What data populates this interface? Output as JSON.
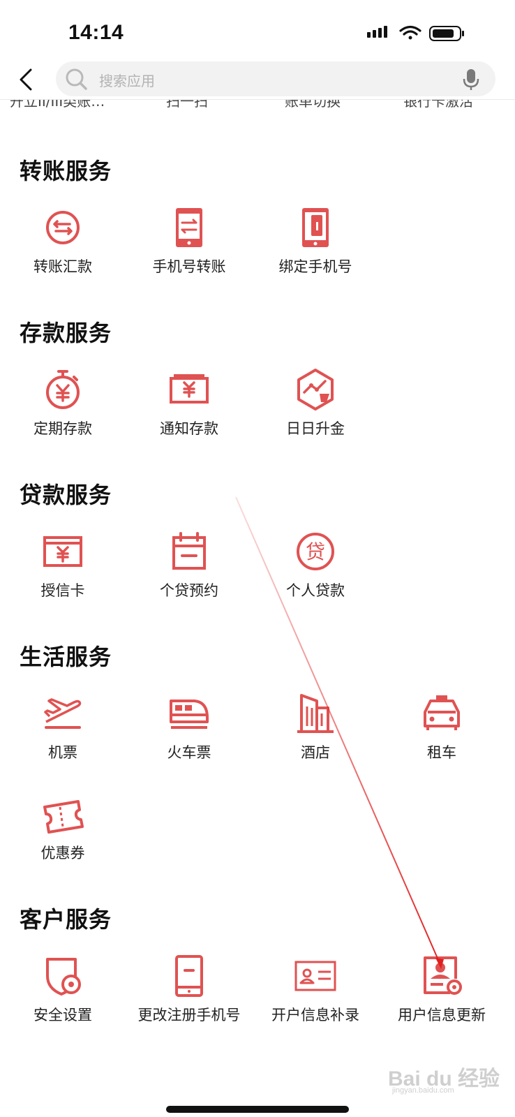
{
  "status": {
    "time": "14:14"
  },
  "search": {
    "placeholder": "搜索应用"
  },
  "top_cut_row": [
    "开立II/III类账…",
    "扫一扫",
    "账单切换",
    "银行卡激活"
  ],
  "sections": [
    {
      "title": "转账服务",
      "items": [
        {
          "label": "转账汇款",
          "icon": "transfer-icon"
        },
        {
          "label": "手机号转账",
          "icon": "phone-transfer-icon"
        },
        {
          "label": "绑定手机号",
          "icon": "bind-phone-icon"
        }
      ]
    },
    {
      "title": "存款服务",
      "items": [
        {
          "label": "定期存款",
          "icon": "time-deposit-icon"
        },
        {
          "label": "通知存款",
          "icon": "notice-deposit-icon"
        },
        {
          "label": "日日升金",
          "icon": "daily-gold-icon"
        }
      ]
    },
    {
      "title": "贷款服务",
      "items": [
        {
          "label": "授信卡",
          "icon": "credit-card-icon"
        },
        {
          "label": "个贷预约",
          "icon": "loan-appointment-icon"
        },
        {
          "label": "个人贷款",
          "icon": "personal-loan-icon"
        }
      ]
    },
    {
      "title": "生活服务",
      "items": [
        {
          "label": "机票",
          "icon": "airplane-icon"
        },
        {
          "label": "火车票",
          "icon": "train-icon"
        },
        {
          "label": "酒店",
          "icon": "hotel-icon"
        },
        {
          "label": "租车",
          "icon": "taxi-icon"
        },
        {
          "label": "优惠券",
          "icon": "coupon-icon"
        }
      ]
    },
    {
      "title": "客户服务",
      "items": [
        {
          "label": "安全设置",
          "icon": "security-settings-icon"
        },
        {
          "label": "更改注册手机号",
          "icon": "change-phone-icon"
        },
        {
          "label": "开户信息补录",
          "icon": "id-card-icon"
        },
        {
          "label": "用户信息更新",
          "icon": "user-info-update-icon"
        }
      ]
    }
  ],
  "watermark": {
    "brand": "Bai du 经验",
    "url": "jingyan.baidu.com"
  },
  "colors": {
    "accent": "#e05252",
    "arrow": "#e02020"
  }
}
